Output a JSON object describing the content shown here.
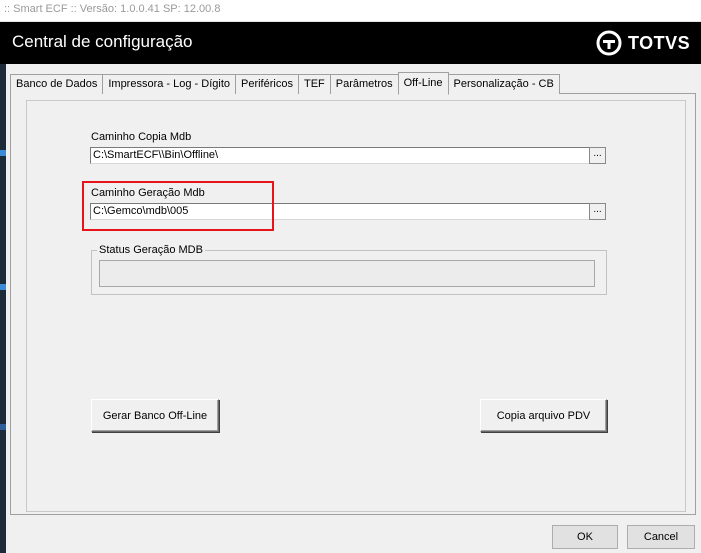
{
  "window": {
    "title": ":: Smart ECF :: Versão: 1.0.0.41 SP: 12.00.8"
  },
  "header": {
    "title": "Central de configuração",
    "logo_text": "TOTVS"
  },
  "tabs": [
    {
      "label": "Banco de Dados",
      "active": false
    },
    {
      "label": "Impressora - Log - Dígito",
      "active": false
    },
    {
      "label": "Periféricos",
      "active": false
    },
    {
      "label": "TEF",
      "active": false
    },
    {
      "label": "Parâmetros",
      "active": false
    },
    {
      "label": "Off-Line",
      "active": true
    },
    {
      "label": "Personalização - CB",
      "active": false
    }
  ],
  "offline": {
    "copy_path_label": "Caminho Copia Mdb",
    "copy_path_value": "C:\\SmartECF\\\\Bin\\Offline\\",
    "gen_path_label": "Caminho Geração Mdb",
    "gen_path_value": "C:\\Gemco\\mdb\\005",
    "browse_label": "...",
    "status_group_label": "Status Geração MDB",
    "status_value": "",
    "generate_button": "Gerar Banco Off-Line",
    "copy_button": "Copia arquivo PDV"
  },
  "dialog": {
    "ok_label": "OK",
    "cancel_label": "Cancel"
  },
  "colors": {
    "banner": "#000000",
    "highlight": "#e8141a"
  }
}
